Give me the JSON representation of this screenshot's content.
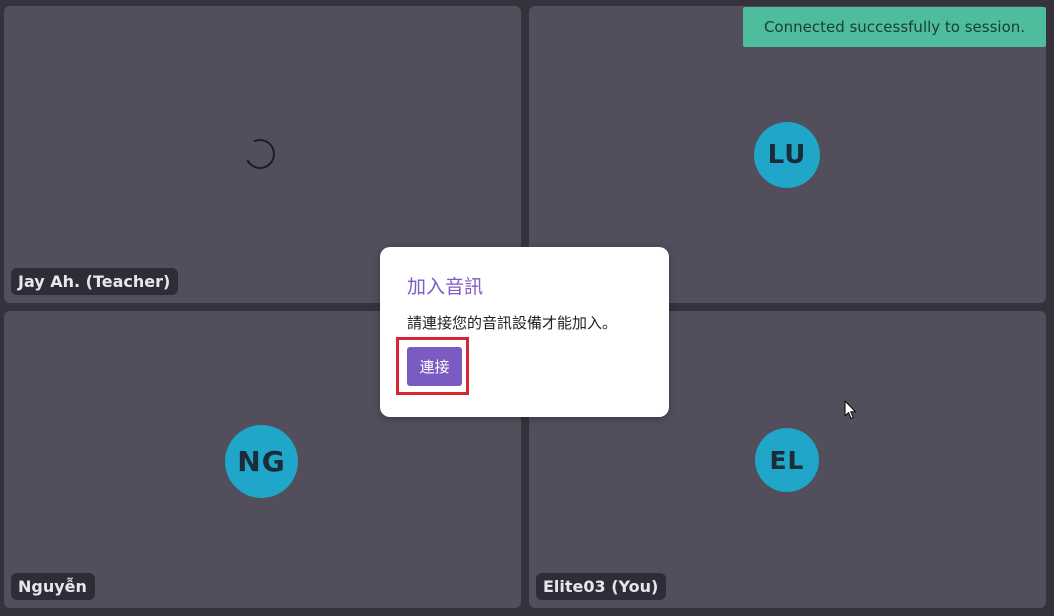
{
  "toast": {
    "message": "Connected successfully to session."
  },
  "tiles": {
    "top_left": {
      "name": "Jay Ah. (Teacher)"
    },
    "top_right": {
      "initials": "LU"
    },
    "bottom_left": {
      "initials": "NG",
      "name": "Nguyễn"
    },
    "bottom_right": {
      "initials": "EL",
      "name": "Elite03 (You)"
    }
  },
  "dialog": {
    "title": "加入音訊",
    "message": "請連接您的音訊設備才能加入。",
    "connect_label": "連接"
  },
  "colors": {
    "background": "#36323d",
    "tile": "#524e5c",
    "avatar": "#1fa6c8",
    "toast": "#4dbd9e",
    "accent": "#7a5bc2",
    "highlight": "#d62633"
  },
  "icons": {
    "loading": "loading-spinner-icon",
    "cursor": "mouse-pointer-icon"
  }
}
